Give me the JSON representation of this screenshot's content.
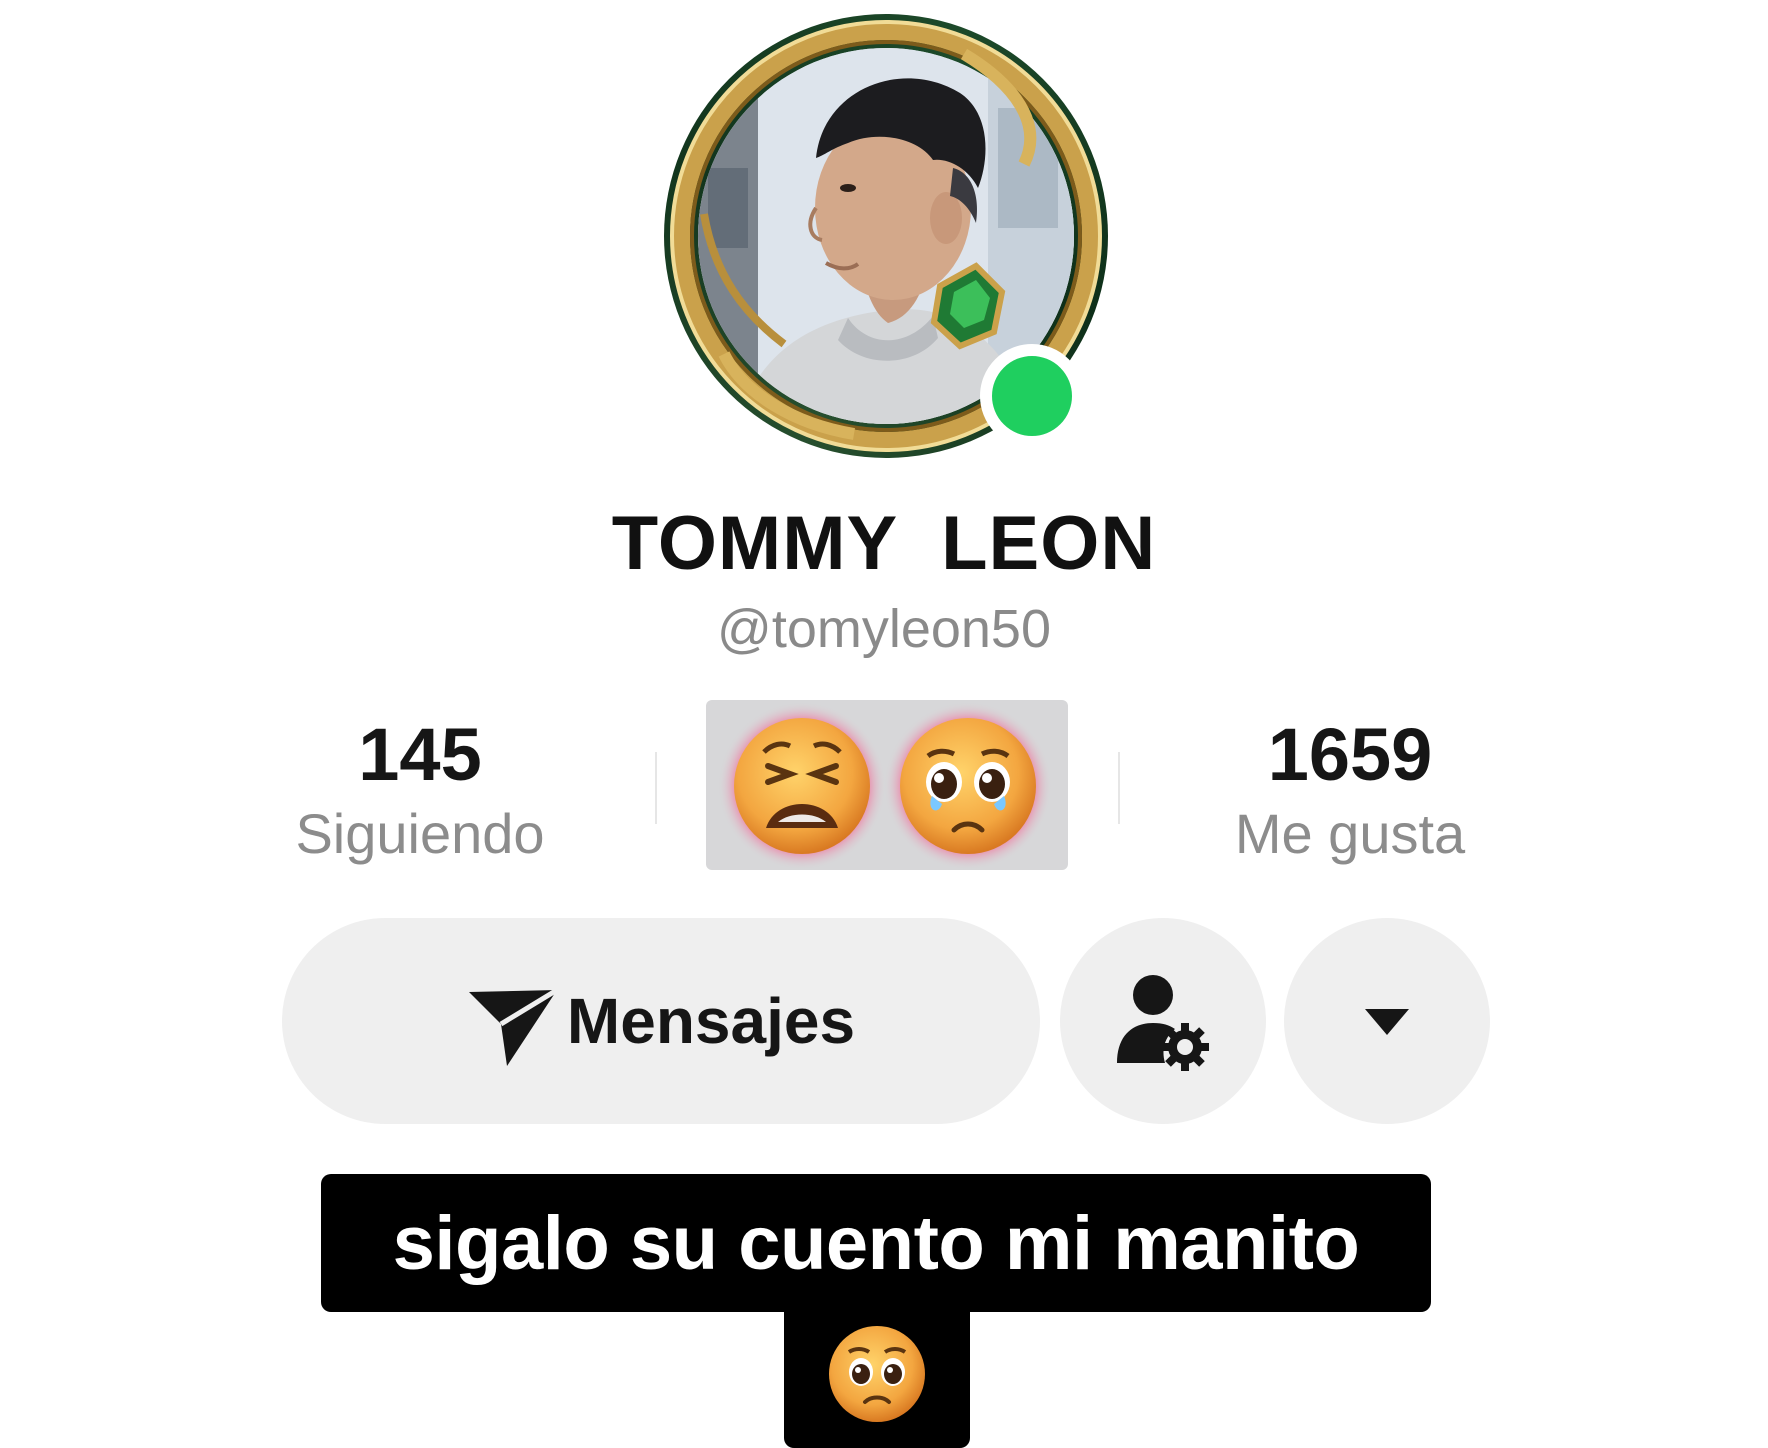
{
  "profile": {
    "display_name": "TOMMY  LEON",
    "username": "@tomyleon50",
    "online": true
  },
  "stats": {
    "following": {
      "value": "145",
      "label": "Siguiendo"
    },
    "likes": {
      "value": "1659",
      "label": "Me gusta"
    },
    "center_sticker": [
      "weary-face-emoji",
      "pleading-face-emoji"
    ]
  },
  "actions": {
    "messages_label": "Mensajes",
    "messages_icon": "send-icon",
    "user_settings_icon": "user-gear-icon",
    "more_icon": "caret-down-icon"
  },
  "caption": {
    "line1": "sigalo su cuento mi manito",
    "line2_emoji": "pleading-face-emoji"
  },
  "colors": {
    "online": "#1fcf5f",
    "button_bg": "#efefef",
    "caption_bg": "#000000",
    "caption_text": "#ffffff"
  }
}
